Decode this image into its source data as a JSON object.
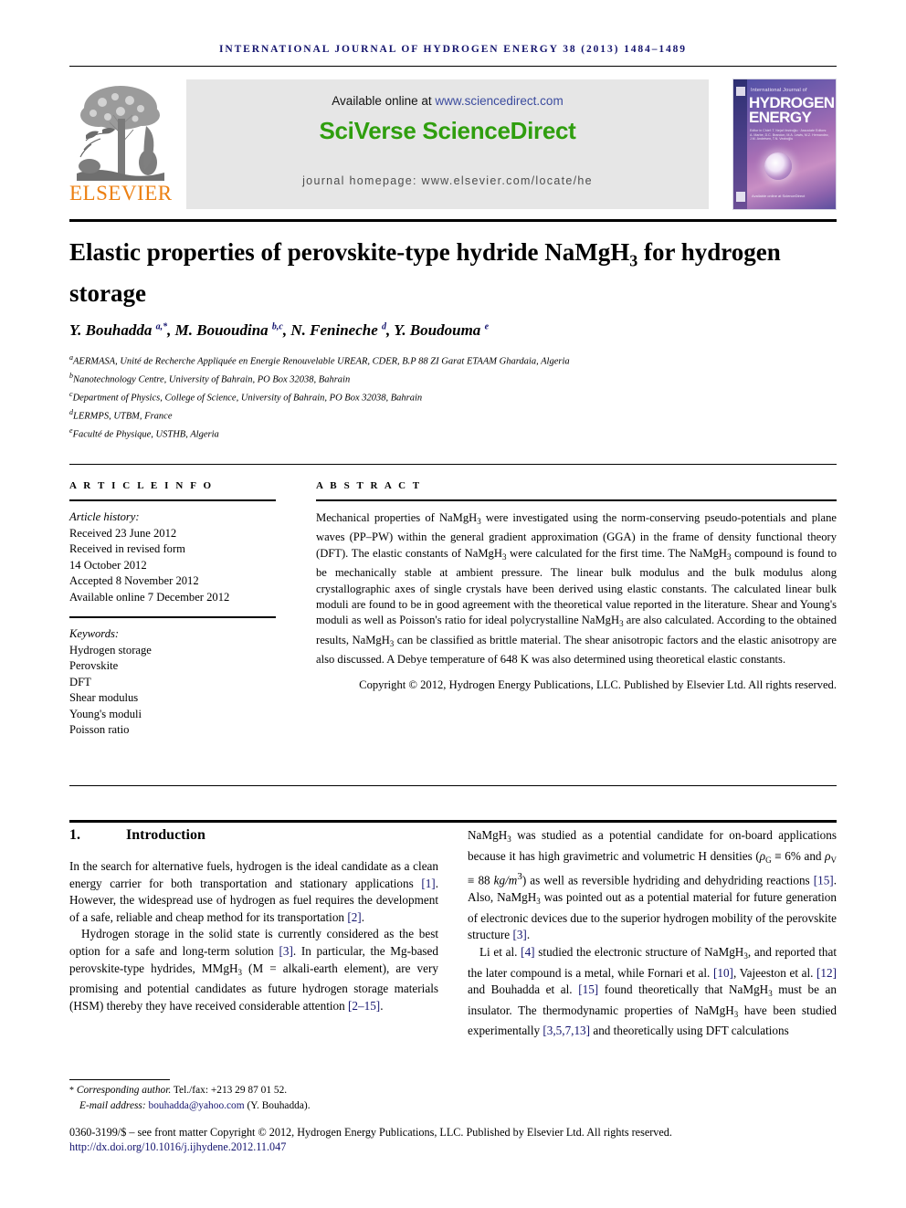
{
  "running_head": "INTERNATIONAL JOURNAL OF HYDROGEN ENERGY 38 (2013) 1484–1489",
  "banner": {
    "publisher_name": "ELSEVIER",
    "available_prefix": "Available online at ",
    "available_url": "www.sciencedirect.com",
    "platform_title": "SciVerse ScienceDirect",
    "homepage_line": "journal homepage: www.elsevier.com/locate/he",
    "cover": {
      "top_line": "International Journal of",
      "head_line1": "HYDROGEN",
      "head_line2": "ENERGY",
      "editors": "Editor in Chief: T. Nejat Veziroğlu · Associate Editors: A. Marbe, D.C. Brandon, M.A. Lewis, M.Z. Hernandez, J.M. Andrésen, T.N. Veziroğlu",
      "footer": "Available online at ScienceDirect"
    }
  },
  "article": {
    "title_part1": "Elastic properties of perovskite-type hydride NaMgH",
    "title_sub": "3",
    "title_part2": " for hydrogen storage",
    "authors_html": "Y. Bouhadda <sup>a,*</sup>, M. Bououdina <sup>b,c</sup>, N. Fenineche <sup>d</sup>, Y. Boudouma <sup>e</sup>",
    "affiliations": [
      {
        "mark": "a",
        "text": "AERMASA, Unité de Recherche Appliquée en Energie Renouvelable UREAR, CDER, B.P 88 ZI Garat ETAAM Ghardaia, Algeria"
      },
      {
        "mark": "b",
        "text": "Nanotechnology Centre, University of Bahrain, PO Box 32038, Bahrain"
      },
      {
        "mark": "c",
        "text": "Department of Physics, College of Science, University of Bahrain, PO Box 32038, Bahrain"
      },
      {
        "mark": "d",
        "text": "LERMPS, UTBM, France"
      },
      {
        "mark": "e",
        "text": "Faculté de Physique, USTHB, Algeria"
      }
    ]
  },
  "article_info": {
    "heading": "A R T I C L E   I N F O",
    "history_label": "Article history:",
    "history": [
      "Received 23 June 2012",
      "Received in revised form",
      "14 October 2012",
      "Accepted 8 November 2012",
      "Available online 7 December 2012"
    ],
    "keywords_label": "Keywords:",
    "keywords": [
      "Hydrogen storage",
      "Perovskite",
      "DFT",
      "Shear modulus",
      "Young's moduli",
      "Poisson ratio"
    ]
  },
  "abstract": {
    "heading": "A B S T R A C T",
    "body_html": "Mechanical properties of NaMgH<span class=\"sub\">3</span> were investigated using the norm-conserving pseudo-potentials and plane waves (PP–PW) within the general gradient approximation (GGA) in the frame of density functional theory (DFT). The elastic constants of NaMgH<span class=\"sub\">3</span> were calculated for the first time. The NaMgH<span class=\"sub\">3</span> compound is found to be mechanically stable at ambient pressure. The linear bulk modulus and the bulk modulus along crystallographic axes of single crystals have been derived using elastic constants. The calculated linear bulk moduli are found to be in good agreement with the theoretical value reported in the literature. Shear and Young's moduli as well as Poisson's ratio for ideal polycrystalline NaMgH<span class=\"sub\">3</span> are also calculated. According to the obtained results, NaMgH<span class=\"sub\">3</span> can be classified as brittle material. The shear anisotropic factors and the elastic anisotropy are also discussed. A Debye temperature of 648 K was also determined using theoretical elastic constants.",
    "copyright_html": "Copyright © 2012, Hydrogen Energy Publications, LLC. Published by Elsevier Ltd. All rights reserved."
  },
  "introduction": {
    "number": "1.",
    "heading": "Introduction",
    "left_paragraphs_html": [
      "In the search for alternative fuels, hydrogen is the ideal candidate as a clean energy carrier for both transportation and stationary applications <span class=\"ref\">[1]</span>. However, the widespread use of hydrogen as fuel requires the development of a safe, reliable and cheap method for its transportation <span class=\"ref\">[2]</span>.",
      "Hydrogen storage in the solid state is currently considered as the best option for a safe and long-term solution <span class=\"ref\">[3]</span>. In particular, the Mg-based perovskite-type hydrides, MMgH<span class=\"sub\">3</span> (M = alkali-earth element), are very promising and potential candidates as future hydrogen storage materials (HSM) thereby they have received considerable attention <span class=\"ref\">[2–15]</span>."
    ],
    "right_paragraphs_html": [
      "NaMgH<span class=\"sub\">3</span> was studied as a potential candidate for on-board applications because it has high gravimetric and volumetric H densities (<span class=\"ital\">ρ</span><span class=\"sub\">G</span> ≡ 6% and <span class=\"ital\">ρ</span><span class=\"sub\">V</span> ≡ 88 <span class=\"ital\">kg/m</span><sup>3</sup>) as well as reversible hydriding and dehydriding reactions <span class=\"ref\">[15]</span>. Also, NaMgH<span class=\"sub\">3</span> was pointed out as a potential material for future generation of electronic devices due to the superior hydrogen mobility of the perovskite structure <span class=\"ref\">[3]</span>.",
      "Li et al. <span class=\"ref\">[4]</span> studied the electronic structure of NaMgH<span class=\"sub\">3</span>, and reported that the later compound is a metal, while Fornari et al. <span class=\"ref\">[10]</span>, Vajeeston et al. <span class=\"ref\">[12]</span> and Bouhadda et al. <span class=\"ref\">[15]</span> found theoretically that NaMgH<span class=\"sub\">3</span> must be an insulator. The thermodynamic properties of NaMgH<span class=\"sub\">3</span> have been studied experimentally <span class=\"ref\">[3,5,7,13]</span> and theoretically using DFT calculations"
    ]
  },
  "footer": {
    "corresponding_html": "<span class=\"star\">*</span> <span class=\"ital\">Corresponding author.</span> Tel./fax: +213 29 87 01 52.",
    "email_label": "E-mail address:",
    "email": "bouhadda@yahoo.com",
    "email_suffix": "(Y. Bouhadda).",
    "issn_html": "0360-3199/$ – see front matter Copyright © 2012, Hydrogen Energy Publications, LLC. Published by Elsevier Ltd. All rights reserved.",
    "doi": "http://dx.doi.org/10.1016/j.ijhydene.2012.11.047"
  },
  "colors": {
    "navy": "#14146e",
    "green": "#2f9e0e",
    "orange": "#ec8013",
    "link_blue": "#3b4b9e",
    "banner_gray": "#e6e6e6"
  }
}
